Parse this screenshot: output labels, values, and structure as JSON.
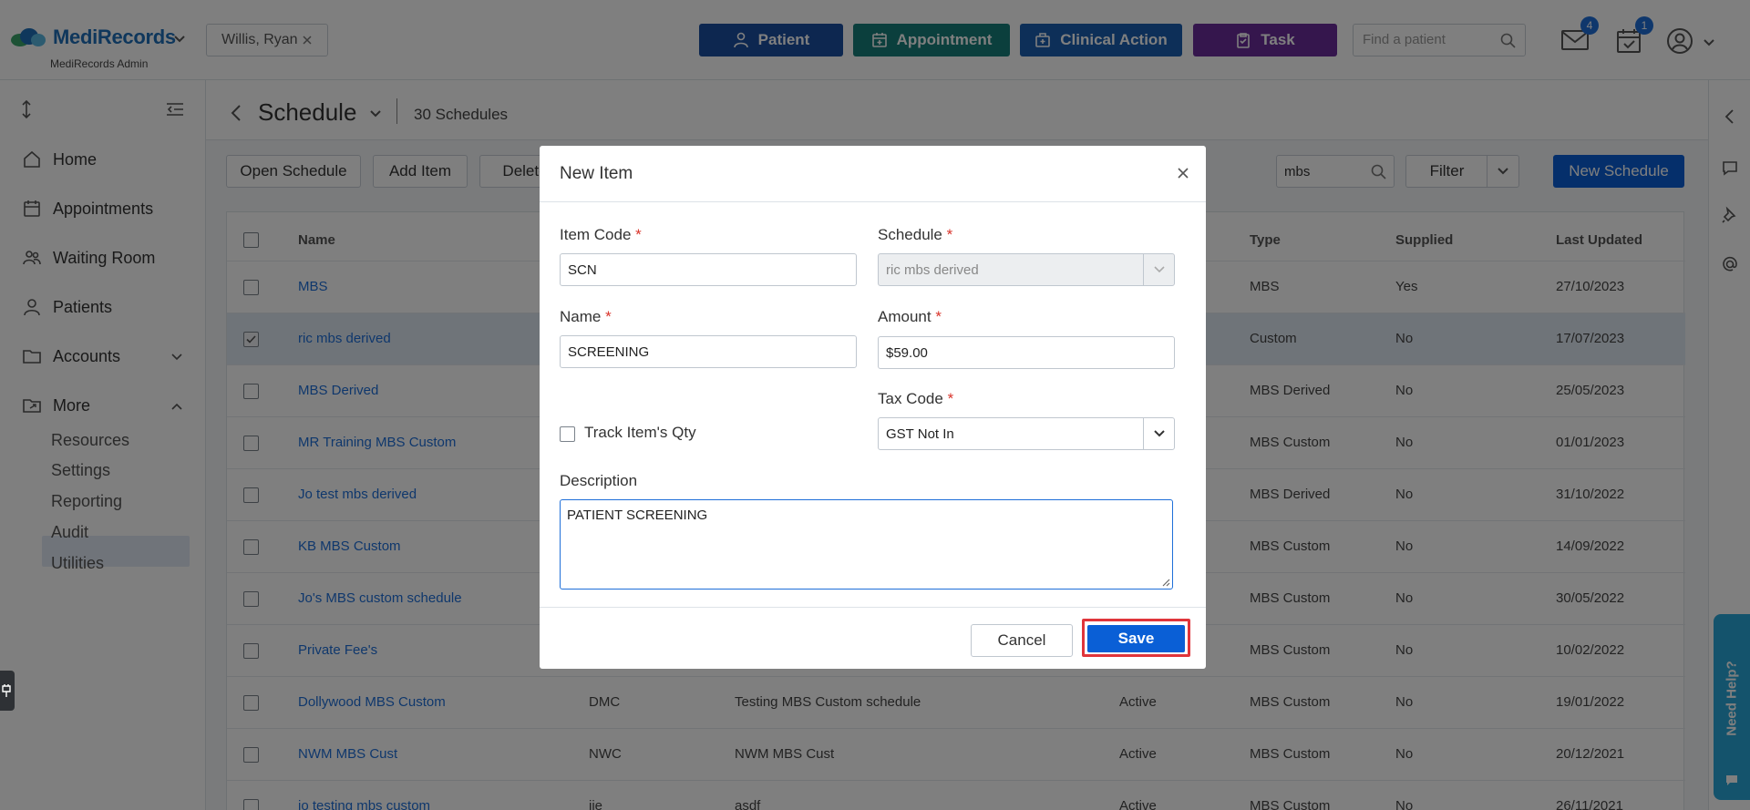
{
  "header": {
    "brand": "MediRecords",
    "brand_sub": "MediRecords Admin",
    "patient_chip": "Willis, Ryan",
    "buttons": {
      "patient": "Patient",
      "appointment": "Appointment",
      "clinical_action": "Clinical Action",
      "task": "Task"
    },
    "colors": {
      "patient": "#1a4fa0",
      "appointment": "#167f7a",
      "clinical_action": "#1a5fb0",
      "task": "#6a2c9a"
    },
    "search_placeholder": "Find a patient",
    "mail_badge": "4",
    "tasks_badge": "1"
  },
  "sidebar": {
    "items": [
      {
        "label": "Home",
        "icon": "home-icon"
      },
      {
        "label": "Appointments",
        "icon": "calendar-icon"
      },
      {
        "label": "Waiting Room",
        "icon": "people-icon"
      },
      {
        "label": "Patients",
        "icon": "person-icon"
      },
      {
        "label": "Accounts",
        "icon": "folder-icon"
      },
      {
        "label": "More",
        "icon": "folder-share-icon"
      }
    ],
    "sub_items": [
      "Resources",
      "Settings",
      "Reporting",
      "Audit",
      "Utilities"
    ]
  },
  "page": {
    "title": "Schedule",
    "count": "30 Schedules",
    "toolbar": {
      "open_schedule": "Open Schedule",
      "add_item": "Add Item",
      "delete": "Delete",
      "search_value": "mbs",
      "filter": "Filter",
      "new_schedule": "New Schedule"
    }
  },
  "table": {
    "columns": {
      "name": "Name",
      "type": "Type",
      "supplied": "Supplied",
      "last_updated": "Last Updated"
    },
    "rows": [
      {
        "name": "MBS",
        "code": "",
        "desc": "",
        "status": "",
        "type": "MBS",
        "supplied": "Yes",
        "updated": "27/10/2023"
      },
      {
        "name": "ric mbs derived",
        "code": "",
        "desc": "",
        "status": "",
        "type": "Custom",
        "supplied": "No",
        "updated": "17/07/2023"
      },
      {
        "name": "MBS Derived",
        "code": "",
        "desc": "",
        "status": "",
        "type": "MBS Derived",
        "supplied": "No",
        "updated": "25/05/2023"
      },
      {
        "name": "MR Training MBS Custom",
        "code": "",
        "desc": "",
        "status": "",
        "type": "MBS Custom",
        "supplied": "No",
        "updated": "01/01/2023"
      },
      {
        "name": "Jo test mbs derived",
        "code": "",
        "desc": "",
        "status": "",
        "type": "MBS Derived",
        "supplied": "No",
        "updated": "31/10/2022"
      },
      {
        "name": "KB MBS Custom",
        "code": "",
        "desc": "",
        "status": "",
        "type": "MBS Custom",
        "supplied": "No",
        "updated": "14/09/2022"
      },
      {
        "name": "Jo's MBS custom schedule",
        "code": "",
        "desc": "",
        "status": "",
        "type": "MBS Custom",
        "supplied": "No",
        "updated": "30/05/2022"
      },
      {
        "name": "Private Fee's",
        "code": "",
        "desc": "",
        "status": "",
        "type": "MBS Custom",
        "supplied": "No",
        "updated": "10/02/2022"
      },
      {
        "name": "Dollywood MBS Custom",
        "code": "DMC",
        "desc": "Testing MBS Custom schedule",
        "status": "Active",
        "type": "MBS Custom",
        "supplied": "No",
        "updated": "19/01/2022"
      },
      {
        "name": "NWM MBS Cust",
        "code": "NWC",
        "desc": "NWM MBS Cust",
        "status": "Active",
        "type": "MBS Custom",
        "supplied": "No",
        "updated": "20/12/2021"
      },
      {
        "name": "jo testing mbs custom",
        "code": "jje",
        "desc": "asdf",
        "status": "Active",
        "type": "MBS Custom",
        "supplied": "No",
        "updated": "26/11/2021"
      }
    ]
  },
  "modal": {
    "title": "New Item",
    "item_code_label": "Item Code",
    "item_code_value": "SCN",
    "schedule_label": "Schedule",
    "schedule_value": "ric mbs derived",
    "name_label": "Name",
    "name_value": "SCREENING",
    "amount_label": "Amount",
    "amount_value": "$59.00",
    "tax_code_label": "Tax Code",
    "tax_code_value": "GST Not In",
    "track_qty_label": "Track Item's Qty",
    "description_label": "Description",
    "description_value": "PATIENT SCREENING",
    "required_mark": "*",
    "cancel": "Cancel",
    "save": "Save"
  },
  "help": {
    "label": "Need Help?"
  }
}
